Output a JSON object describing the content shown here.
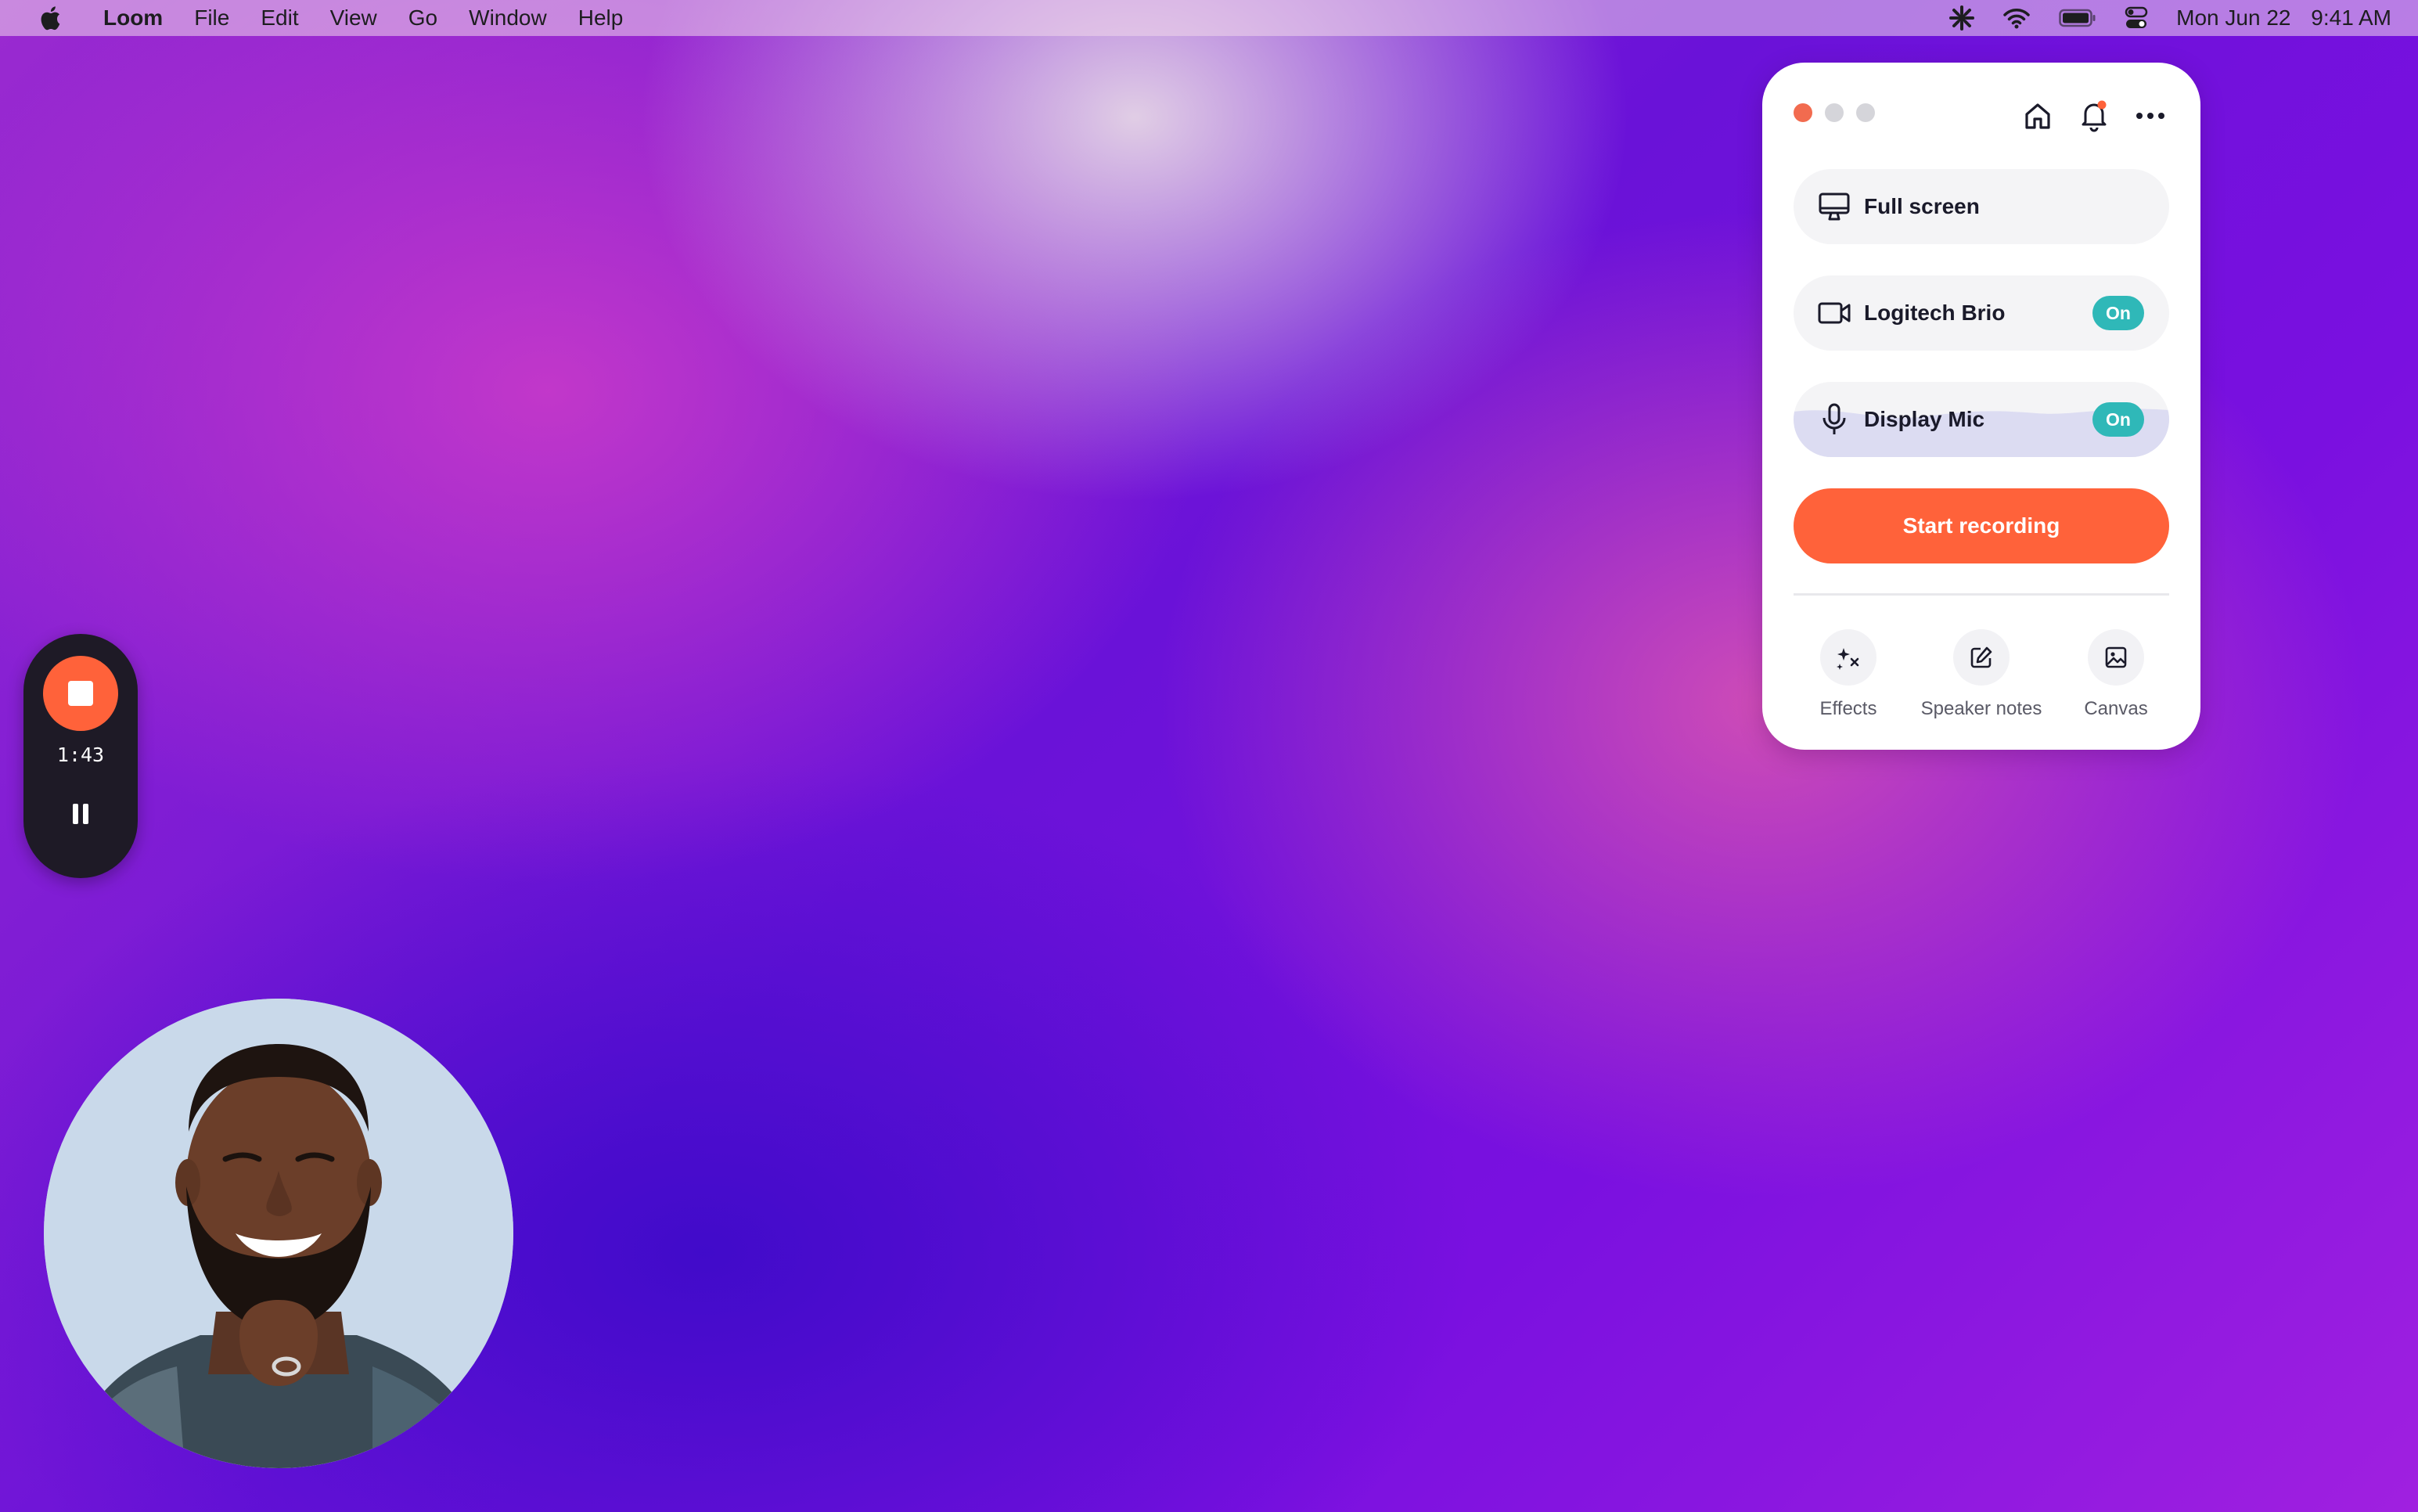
{
  "menubar": {
    "app_name": "Loom",
    "items": [
      "File",
      "Edit",
      "View",
      "Go",
      "Window",
      "Help"
    ],
    "date": "Mon Jun 22",
    "time": "9:41 AM"
  },
  "panel": {
    "rows": {
      "screen": {
        "label": "Full screen"
      },
      "camera": {
        "label": "Logitech Brio",
        "toggle": "On"
      },
      "mic": {
        "label": "Display Mic",
        "toggle": "On"
      }
    },
    "start_label": "Start recording",
    "tools": [
      {
        "label": "Effects",
        "icon": "effects-icon"
      },
      {
        "label": "Speaker notes",
        "icon": "edit-icon"
      },
      {
        "label": "Canvas",
        "icon": "image-icon"
      }
    ]
  },
  "recorder": {
    "timer": "1:43"
  },
  "colors": {
    "accent": "#ff623a",
    "toggle_on": "#2fb8b8",
    "close_dot": "#f26b4f",
    "notification_dot": "#ff623a"
  }
}
